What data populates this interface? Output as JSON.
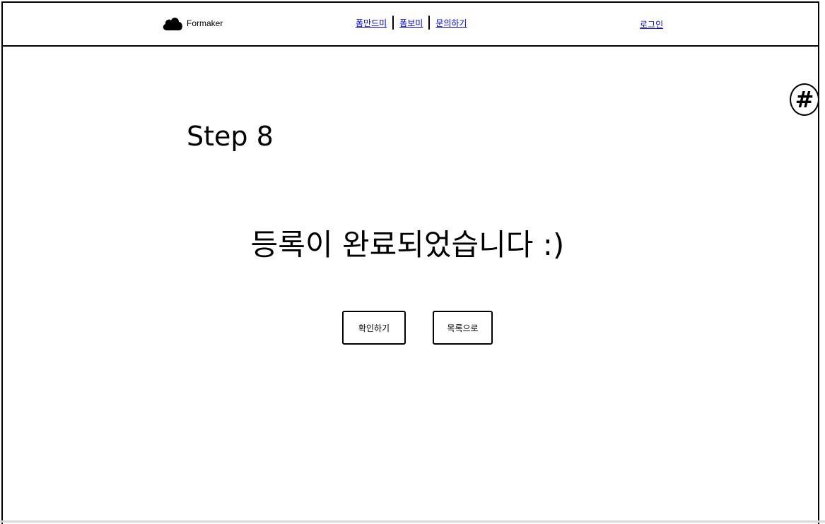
{
  "header": {
    "logo_text": "Formaker",
    "logo_icon": "cloud-icon",
    "nav": [
      {
        "label": "폼만드미"
      },
      {
        "label": "폼보미"
      },
      {
        "label": "문의하기"
      }
    ],
    "login_label": "로그인"
  },
  "floating": {
    "hash_label": "#"
  },
  "main": {
    "step_title": "Step 8",
    "message": "등록이 완료되었습니다 :)",
    "confirm_label": "확인하기",
    "list_label": "목록으로"
  }
}
